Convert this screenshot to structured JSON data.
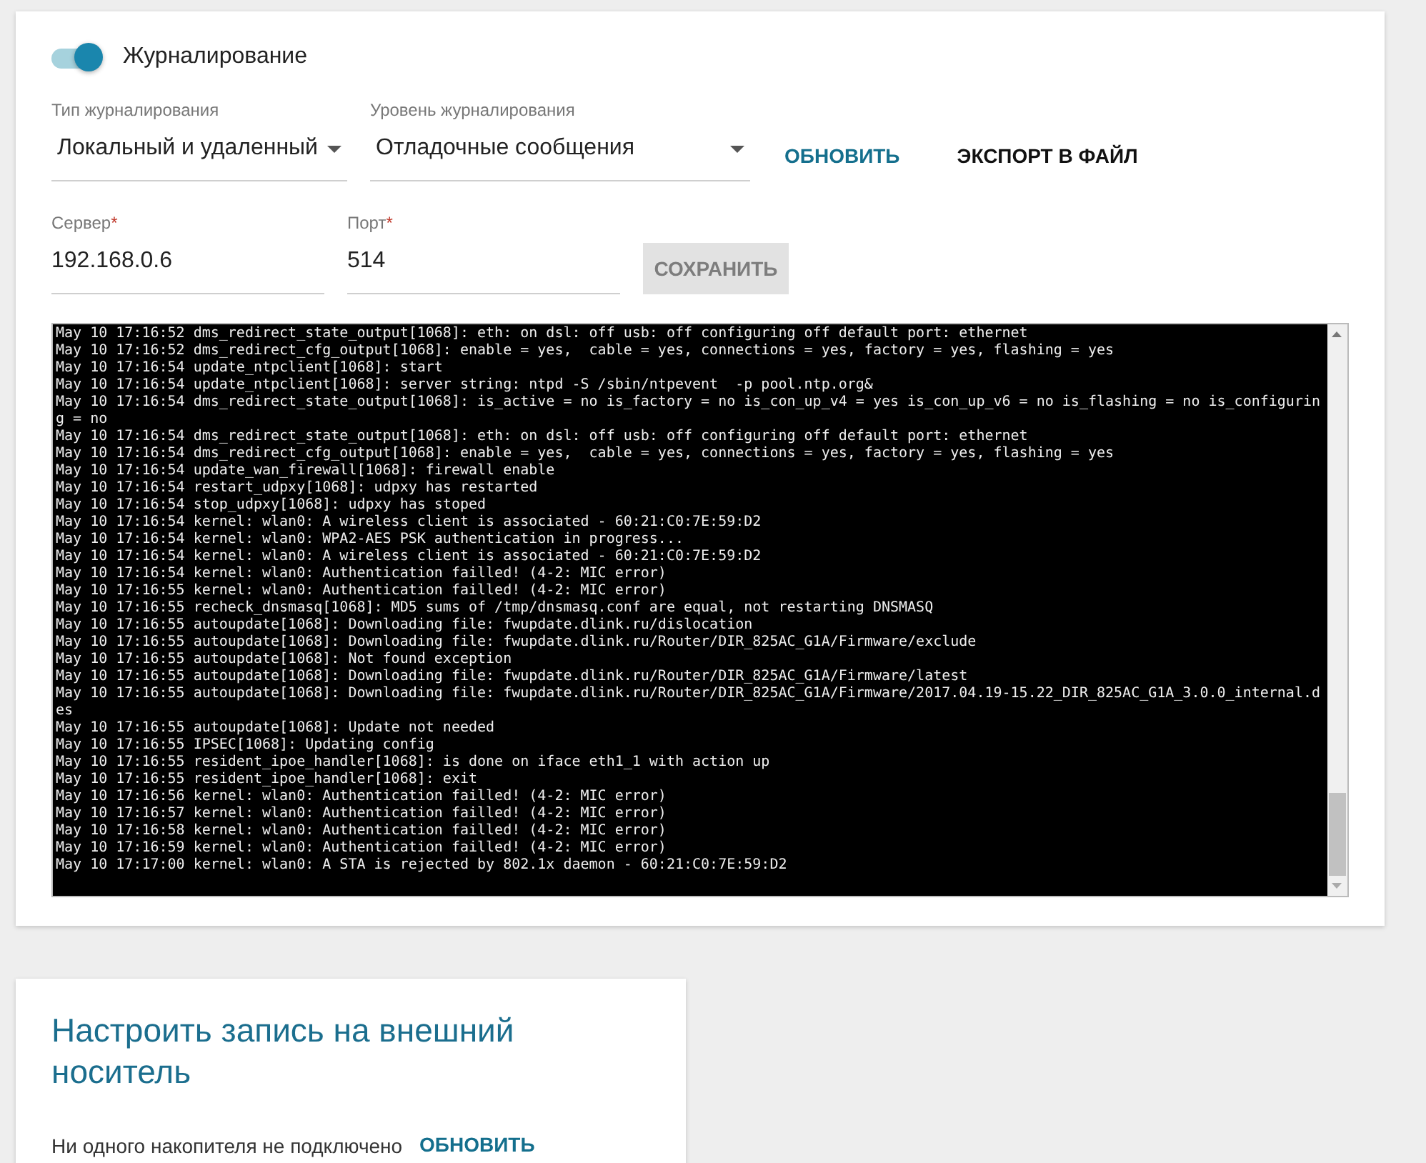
{
  "logging": {
    "toggle": {
      "label": "Журналирование",
      "on": true
    },
    "log_type": {
      "label": "Тип журналирования",
      "value": "Локальный и удаленный"
    },
    "log_level": {
      "label": "Уровень журналирования",
      "value": "Отладочные сообщения"
    },
    "refresh_button": "ОБНОВИТЬ",
    "export_button": "ЭКСПОРТ В ФАЙЛ",
    "server": {
      "label": "Сервер",
      "required_mark": "*",
      "value": "192.168.0.6"
    },
    "port": {
      "label": "Порт",
      "required_mark": "*",
      "value": "514"
    },
    "save_button": {
      "label": "СОХРАНИТЬ",
      "disabled": true
    },
    "log_lines": [
      "May 10 17:16:52 dms_redirect_state_output[1068]: eth: on dsl: off usb: off configuring off default port: ethernet",
      "May 10 17:16:52 dms_redirect_cfg_output[1068]: enable = yes,  cable = yes, connections = yes, factory = yes, flashing = yes",
      "May 10 17:16:54 update_ntpclient[1068]: start",
      "May 10 17:16:54 update_ntpclient[1068]: server string: ntpd -S /sbin/ntpevent  -p pool.ntp.org&",
      "May 10 17:16:54 dms_redirect_state_output[1068]: is_active = no is_factory = no is_con_up_v4 = yes is_con_up_v6 = no is_flashing = no is_configuring = no",
      "May 10 17:16:54 dms_redirect_state_output[1068]: eth: on dsl: off usb: off configuring off default port: ethernet",
      "May 10 17:16:54 dms_redirect_cfg_output[1068]: enable = yes,  cable = yes, connections = yes, factory = yes, flashing = yes",
      "May 10 17:16:54 update_wan_firewall[1068]: firewall enable",
      "May 10 17:16:54 restart_udpxy[1068]: udpxy has restarted",
      "May 10 17:16:54 stop_udpxy[1068]: udpxy has stoped",
      "May 10 17:16:54 kernel: wlan0: A wireless client is associated - 60:21:C0:7E:59:D2",
      "May 10 17:16:54 kernel: wlan0: WPA2-AES PSK authentication in progress...",
      "May 10 17:16:54 kernel: wlan0: A wireless client is associated - 60:21:C0:7E:59:D2",
      "May 10 17:16:54 kernel: wlan0: Authentication failled! (4-2: MIC error)",
      "May 10 17:16:55 kernel: wlan0: Authentication failled! (4-2: MIC error)",
      "May 10 17:16:55 recheck_dnsmasq[1068]: MD5 sums of /tmp/dnsmasq.conf are equal, not restarting DNSMASQ",
      "May 10 17:16:55 autoupdate[1068]: Downloading file: fwupdate.dlink.ru/dislocation",
      "May 10 17:16:55 autoupdate[1068]: Downloading file: fwupdate.dlink.ru/Router/DIR_825AC_G1A/Firmware/exclude",
      "May 10 17:16:55 autoupdate[1068]: Not found exception",
      "May 10 17:16:55 autoupdate[1068]: Downloading file: fwupdate.dlink.ru/Router/DIR_825AC_G1A/Firmware/latest",
      "May 10 17:16:55 autoupdate[1068]: Downloading file: fwupdate.dlink.ru/Router/DIR_825AC_G1A/Firmware/2017.04.19-15.22_DIR_825AC_G1A_3.0.0_internal.des",
      "May 10 17:16:55 autoupdate[1068]: Update not needed",
      "May 10 17:16:55 IPSEC[1068]: Updating config",
      "May 10 17:16:55 resident_ipoe_handler[1068]: is done on iface eth1_1 with action up",
      "May 10 17:16:55 resident_ipoe_handler[1068]: exit",
      "May 10 17:16:56 kernel: wlan0: Authentication failled! (4-2: MIC error)",
      "May 10 17:16:57 kernel: wlan0: Authentication failled! (4-2: MIC error)",
      "May 10 17:16:58 kernel: wlan0: Authentication failled! (4-2: MIC error)",
      "May 10 17:16:59 kernel: wlan0: Authentication failled! (4-2: MIC error)",
      "May 10 17:17:00 kernel: wlan0: A STA is rejected by 802.1x daemon - 60:21:C0:7E:59:D2"
    ]
  },
  "external_storage": {
    "title": "Настроить запись на внешний носитель",
    "message": "Ни одного накопителя не подключено",
    "refresh_button": "ОБНОВИТЬ"
  }
}
